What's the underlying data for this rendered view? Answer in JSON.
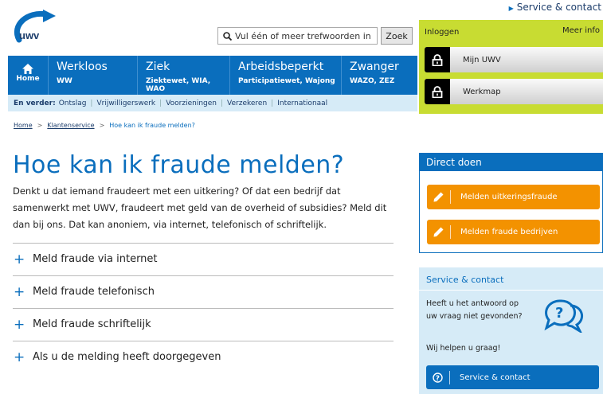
{
  "header": {
    "service_link": "Service & contact",
    "logo_text": "uwv",
    "search_placeholder": "Vul één of meer trefwoorden in",
    "search_button": "Zoek"
  },
  "nav": {
    "home": "Home",
    "items": [
      {
        "title": "Werkloos",
        "sub": "WW"
      },
      {
        "title": "Ziek",
        "sub": "Ziektewet, WIA, WAO"
      },
      {
        "title": "Arbeidsbeperkt",
        "sub": "Participatiewet, Wajong"
      },
      {
        "title": "Zwanger",
        "sub": "WAZO, ZEZ"
      }
    ],
    "subnav_label": "En verder:",
    "subnav_items": [
      "Ontslag",
      "Vrijwilligerswerk",
      "Voorzieningen",
      "Verzekeren",
      "Internationaal"
    ]
  },
  "login": {
    "heading": "Inloggen",
    "more": "Meer info",
    "buttons": [
      "Mijn UWV",
      "Werkmap"
    ]
  },
  "breadcrumb": {
    "home": "Home",
    "klantenservice": "Klantenservice",
    "current": "Hoe kan ik fraude melden?"
  },
  "content": {
    "title": "Hoe kan ik fraude melden?",
    "intro": "Denkt u dat iemand fraudeert met een uitkering? Of dat een bedrijf dat samenwerkt met UWV, fraudeert met geld van de overheid of subsidies? Meld dit dan bij ons. Dat kan anoniem, via internet, telefonisch of schriftelijk.",
    "accordion": [
      "Meld fraude via internet",
      "Meld fraude telefonisch",
      "Meld fraude schriftelijk",
      "Als u de melding heeft doorgegeven"
    ]
  },
  "direct_doen": {
    "heading": "Direct doen",
    "buttons": [
      "Melden uitkeringsfraude",
      "Melden fraude bedrijven"
    ]
  },
  "service_contact": {
    "heading": "Service & contact",
    "text": "Heeft u het antwoord op uw vraag niet gevonden?",
    "help": "Wij helpen u graag!",
    "button": "Service & contact"
  },
  "colors": {
    "brand_blue": "#0a6ebd",
    "login_green": "#c8dc32",
    "action_orange": "#f39200",
    "light_blue": "#d6ebf7"
  }
}
